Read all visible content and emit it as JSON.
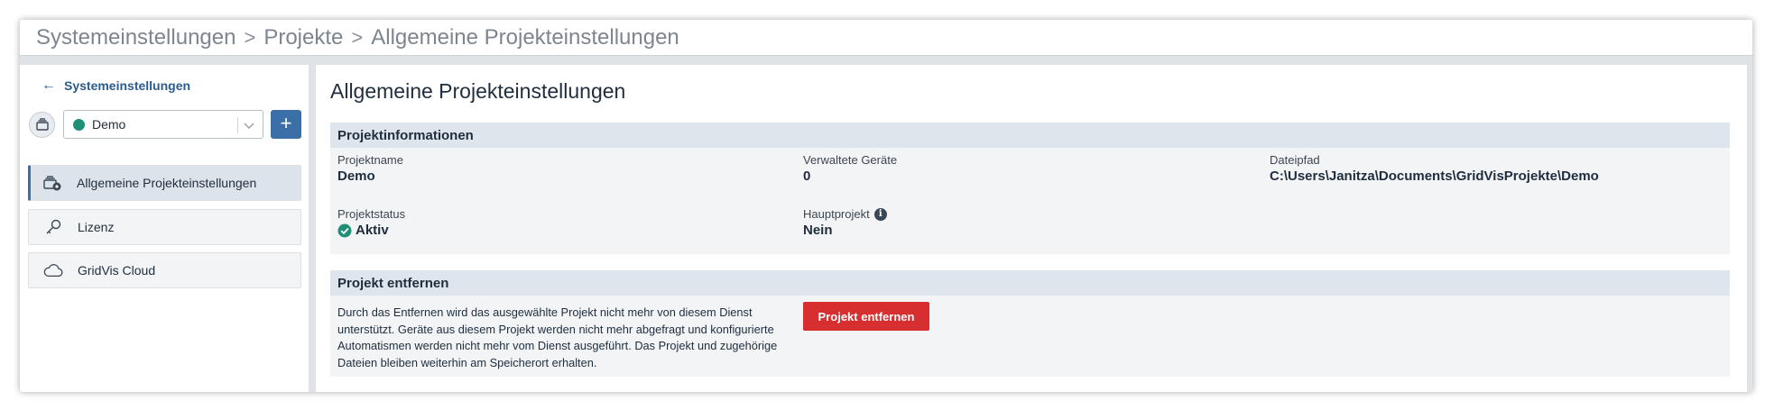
{
  "breadcrumb": [
    "Systemeinstellungen",
    "Projekte",
    "Allgemeine Projekteinstellungen"
  ],
  "breadcrumb_separator": ">",
  "sidebar": {
    "back_label": "Systemeinstellungen",
    "project_select": {
      "value": "Demo",
      "status_color": "#1f8f78"
    },
    "add_label": "+",
    "items": [
      {
        "label": "Allgemeine Projekteinstellungen",
        "icon": "project-settings-icon",
        "active": true
      },
      {
        "label": "Lizenz",
        "icon": "key-icon",
        "active": false
      },
      {
        "label": "GridVis Cloud",
        "icon": "cloud-icon",
        "active": false
      }
    ]
  },
  "main": {
    "title": "Allgemeine Projekteinstellungen",
    "info_section": {
      "title": "Projektinformationen",
      "fields": {
        "project_name": {
          "label": "Projektname",
          "value": "Demo"
        },
        "managed_devices": {
          "label": "Verwaltete Geräte",
          "value": "0"
        },
        "file_path": {
          "label": "Dateipfad",
          "value": "C:\\Users\\Janitza\\Documents\\GridVisProjekte\\Demo"
        },
        "project_status": {
          "label": "Projektstatus",
          "value": "Aktiv"
        },
        "main_project": {
          "label": "Hauptprojekt",
          "value": "Nein",
          "info_icon": "i"
        }
      }
    },
    "remove_section": {
      "title": "Projekt entfernen",
      "text": "Durch das Entfernen wird das ausgewählte Projekt nicht mehr von diesem Dienst unterstützt. Geräte aus diesem Projekt werden nicht mehr abgefragt und konfigurierte Automatismen werden nicht mehr vom Dienst ausgeführt. Das Projekt und zugehörige Dateien bleiben weiterhin am Speicherort erhalten.",
      "button_label": "Projekt entfernen"
    }
  },
  "colors": {
    "accent": "#3a6fa8",
    "danger": "#d72f2f",
    "status_ok": "#1f8f78"
  }
}
